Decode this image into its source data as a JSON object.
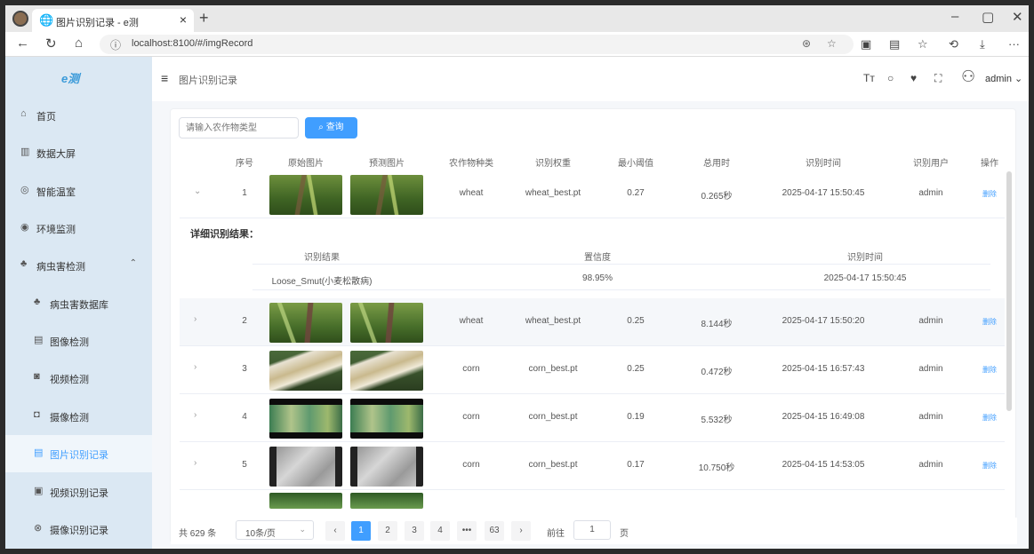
{
  "browser": {
    "tab_title": "图片识别记录 - e测",
    "url": "localhost:8100/#/imgRecord"
  },
  "sidebar": {
    "logo": "e测",
    "items": [
      {
        "label": "首页",
        "icon": "home-icon"
      },
      {
        "label": "数据大屏",
        "icon": "chart-icon"
      },
      {
        "label": "智能温室",
        "icon": "greenhouse-icon"
      },
      {
        "label": "环境监测",
        "icon": "environment-icon"
      },
      {
        "label": "病虫害检测",
        "icon": "bug-icon"
      },
      {
        "label": "病虫害数据库",
        "icon": "database-icon"
      },
      {
        "label": "图像检测",
        "icon": "image-icon"
      },
      {
        "label": "视频检测",
        "icon": "video-icon"
      },
      {
        "label": "摄像检测",
        "icon": "camera-icon"
      },
      {
        "label": "图片识别记录",
        "icon": "image-record-icon"
      },
      {
        "label": "视频识别记录",
        "icon": "video-record-icon"
      },
      {
        "label": "摄像识别记录",
        "icon": "camera-record-icon"
      }
    ]
  },
  "header": {
    "breadcrumb": "图片识别记录",
    "user": "admin"
  },
  "search": {
    "placeholder": "请输入农作物类型",
    "button": "查询"
  },
  "table": {
    "columns": [
      "序号",
      "原始图片",
      "预测图片",
      "农作物种类",
      "识别权重",
      "最小阈值",
      "总用时",
      "识别时间",
      "识别用户",
      "操作"
    ],
    "rows": [
      {
        "index": "1",
        "crop": "wheat",
        "weight": "wheat_best.pt",
        "threshold": "0.27",
        "time_used": "0.265秒",
        "time": "2025-04-17 15:50:45",
        "user": "admin",
        "op": "删除",
        "expanded": true
      },
      {
        "index": "2",
        "crop": "wheat",
        "weight": "wheat_best.pt",
        "threshold": "0.25",
        "time_used": "8.144秒",
        "time": "2025-04-17 15:50:20",
        "user": "admin",
        "op": "删除"
      },
      {
        "index": "3",
        "crop": "corn",
        "weight": "corn_best.pt",
        "threshold": "0.25",
        "time_used": "0.472秒",
        "time": "2025-04-15 16:57:43",
        "user": "admin",
        "op": "删除"
      },
      {
        "index": "4",
        "crop": "corn",
        "weight": "corn_best.pt",
        "threshold": "0.19",
        "time_used": "5.532秒",
        "time": "2025-04-15 16:49:08",
        "user": "admin",
        "op": "删除"
      },
      {
        "index": "5",
        "crop": "corn",
        "weight": "corn_best.pt",
        "threshold": "0.17",
        "time_used": "10.750秒",
        "time": "2025-04-15 14:53:05",
        "user": "admin",
        "op": "删除"
      }
    ],
    "detail": {
      "title": "详细识别结果：",
      "columns": [
        "识别结果",
        "置信度",
        "识别时间"
      ],
      "result": "Loose_Smut(小麦松散病)",
      "confidence": "98.95%",
      "time": "2025-04-17 15:50:45"
    }
  },
  "pagination": {
    "total": "共 629 条",
    "page_size": "10条/页",
    "pages": [
      "1",
      "2",
      "3",
      "4",
      "•••",
      "63"
    ],
    "current": "1",
    "goto_label": "前往",
    "goto_value": "1",
    "goto_suffix": "页"
  }
}
